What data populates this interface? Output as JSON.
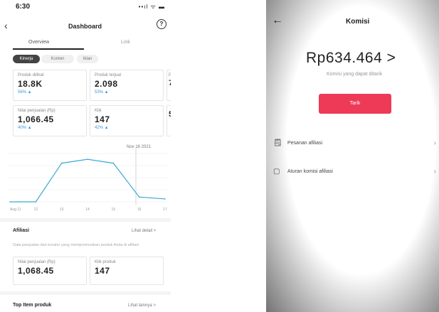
{
  "dashboard": {
    "status_bar": {
      "time": "6:30",
      "icons": "••ıl ᯤ ▬"
    },
    "title": "Dashboard",
    "help_icon": "?",
    "tabs": [
      "Overview",
      "Link"
    ],
    "chips": [
      "Kinerja",
      "Konten",
      "Iklan"
    ],
    "metrics": [
      {
        "label": "Produk dilihat",
        "value": "18.8K",
        "change": "56% ▲"
      },
      {
        "label": "Produk terjual",
        "value": "2.098",
        "change": "53% ▲"
      },
      {
        "label": "Po",
        "value": "7",
        "change": ""
      },
      {
        "label": "Nilai penjualan (Rp)",
        "value": "1,066.45",
        "change": "40% ▲"
      },
      {
        "label": "Klik",
        "value": "147",
        "change": "42% ▲"
      },
      {
        "label": "",
        "value": "5",
        "change": ""
      }
    ],
    "chart_label": "Nov 16 2021",
    "chart_data": {
      "type": "line",
      "x": [
        "Aug 11",
        "12",
        "13",
        "14",
        "15",
        "16",
        "17"
      ],
      "xticks": [
        "Aug 11",
        "12",
        "13",
        "14",
        "15",
        "16",
        "17"
      ],
      "values": [
        0,
        0,
        4,
        4.4,
        4,
        0.5,
        0.3
      ],
      "color": "#3aa9d4"
    },
    "affiliate": {
      "title": "Afiliasi",
      "link": "Lihat detail >",
      "description": "Data penjualan dari kreator yang mempromosikan produk Anda di afiliasi",
      "cards": [
        {
          "label": "Nilai penjualan (Rp)",
          "value": "1,068.45"
        },
        {
          "label": "Klik produk",
          "value": "147"
        }
      ]
    },
    "top_products": {
      "title": "Top Item produk",
      "link": "Lihat lainnya >"
    }
  },
  "komisi": {
    "title": "Komisi",
    "amount": "Rp634.464",
    "amount_arrow": ">",
    "subtitle": "Komisi yang dapat ditarik",
    "button": "Tarik",
    "rows": [
      {
        "label": "Pesanan afiliasi",
        "icon": "document-icon"
      },
      {
        "label": "Aturan komisi afiliasi",
        "icon": "info-icon"
      }
    ]
  }
}
